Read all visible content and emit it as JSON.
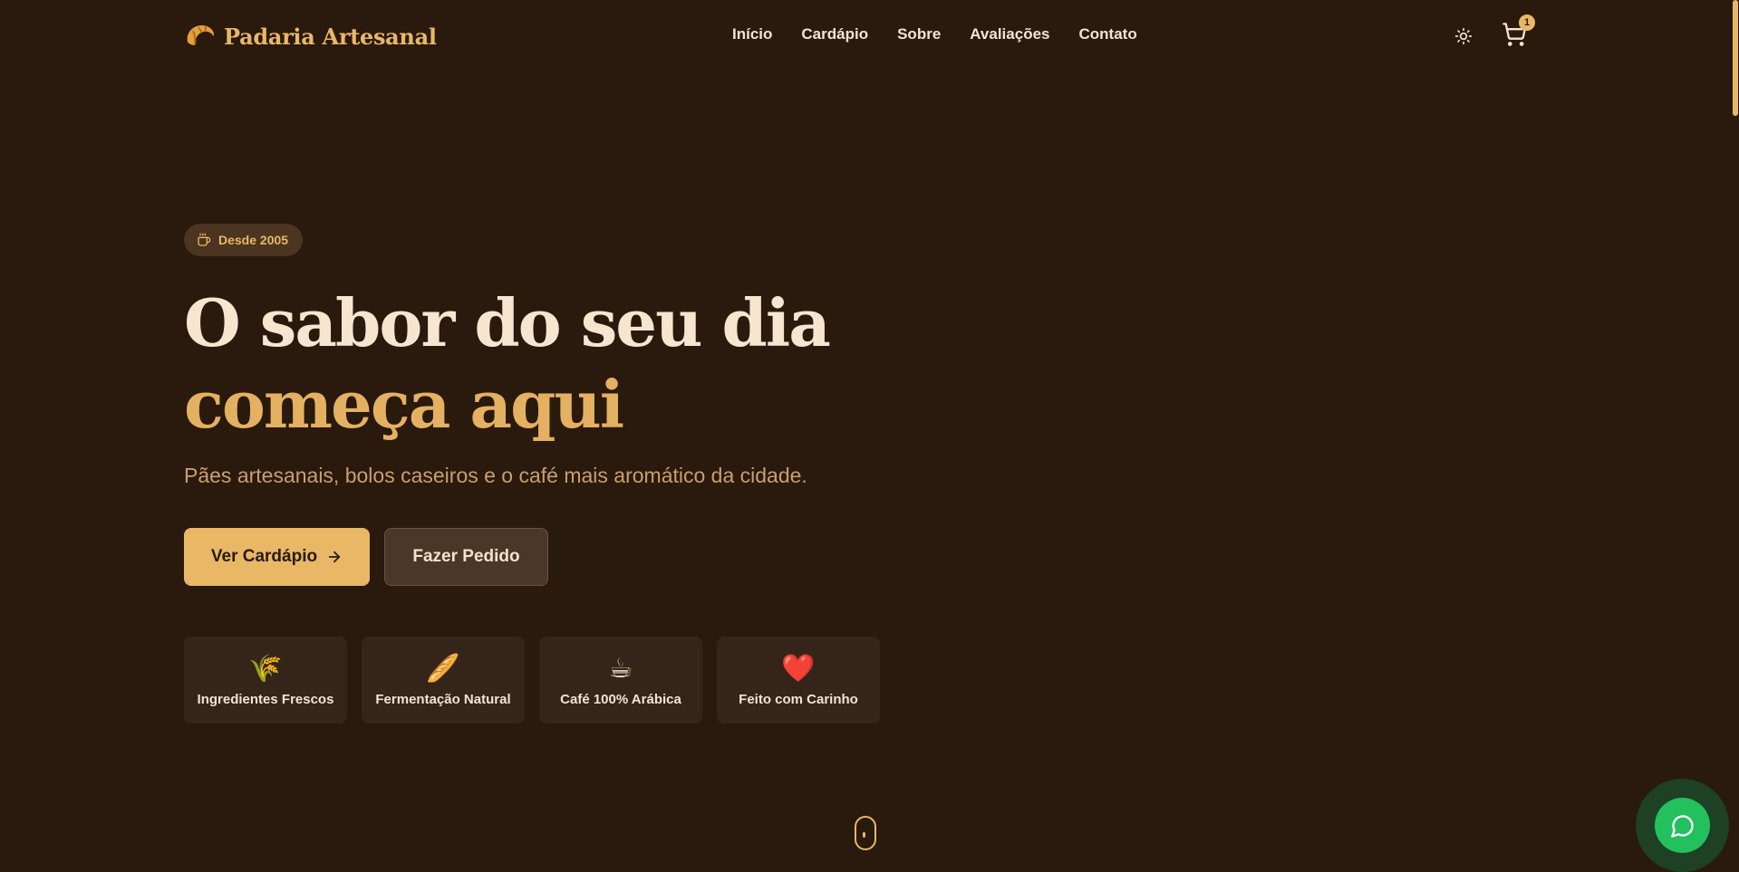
{
  "brand": {
    "name": "Padaria Artesanal",
    "logo_icon": "croissant-icon",
    "accent": "#e8b866"
  },
  "nav": {
    "items": [
      {
        "label": "Início"
      },
      {
        "label": "Cardápio"
      },
      {
        "label": "Sobre"
      },
      {
        "label": "Avaliações"
      },
      {
        "label": "Contato"
      }
    ]
  },
  "header_actions": {
    "theme_icon": "sun-icon",
    "cart_icon": "cart-icon",
    "cart_count": "1"
  },
  "hero": {
    "badge": "Desde 2005",
    "badge_icon": "coffee-cup-icon",
    "title_line1": "O sabor do seu dia",
    "title_line2": "começa aqui",
    "subtitle": "Pães artesanais, bolos caseiros e o café mais aromático da cidade.",
    "primary_button": "Ver Cardápio",
    "secondary_button": "Fazer Pedido"
  },
  "features": [
    {
      "icon": "🌾",
      "label": "Ingredientes Frescos"
    },
    {
      "icon": "🥖",
      "label": "Fermentação Natural"
    },
    {
      "icon": "☕",
      "label": "Café 100% Arábica"
    },
    {
      "icon": "❤️",
      "label": "Feito com Carinho"
    }
  ],
  "colors": {
    "background": "#2a190d",
    "whatsapp": "#22c15e"
  }
}
